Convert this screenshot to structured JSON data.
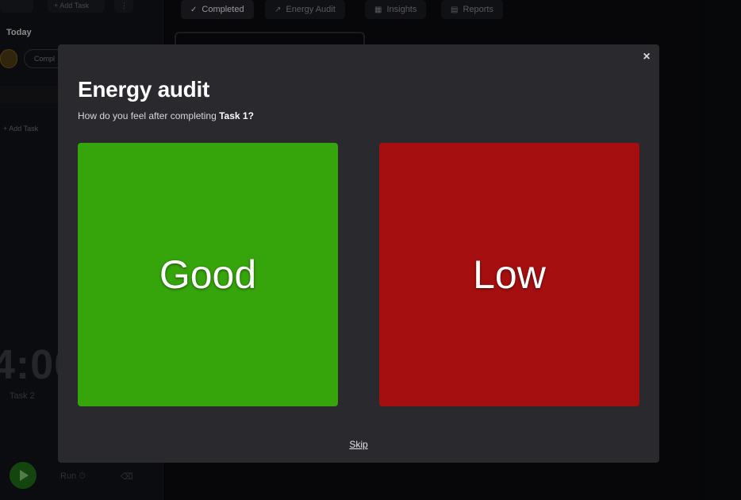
{
  "background": {
    "sidebar": {
      "top_buttons": [
        "",
        "+ Add Task",
        "⋮"
      ],
      "section_title": "Today",
      "filter_pill": "Compl",
      "add_task": "+ Add Task",
      "timer": "4:00",
      "timer_task": "Task 2",
      "bottom_left": "Run ⏱",
      "bottom_right": "⌫"
    },
    "tabs": [
      {
        "icon": "check-icon",
        "glyph": "✓",
        "label": "Completed"
      },
      {
        "icon": "trend-icon",
        "glyph": "↗",
        "label": "Energy Audit"
      },
      {
        "icon": "chart-icon",
        "glyph": "▦",
        "label": "Insights"
      },
      {
        "icon": "document-icon",
        "glyph": "▤",
        "label": "Reports"
      }
    ]
  },
  "modal": {
    "title": "Energy audit",
    "subtitle_prefix": "How do you feel after completing ",
    "subtitle_task": "Task 1?",
    "close_glyph": "×",
    "good_label": "Good",
    "low_label": "Low",
    "skip_label": "Skip",
    "colors": {
      "good": "#36a50b",
      "low": "#a60f0f",
      "modal_bg": "#2a2a2e"
    }
  }
}
